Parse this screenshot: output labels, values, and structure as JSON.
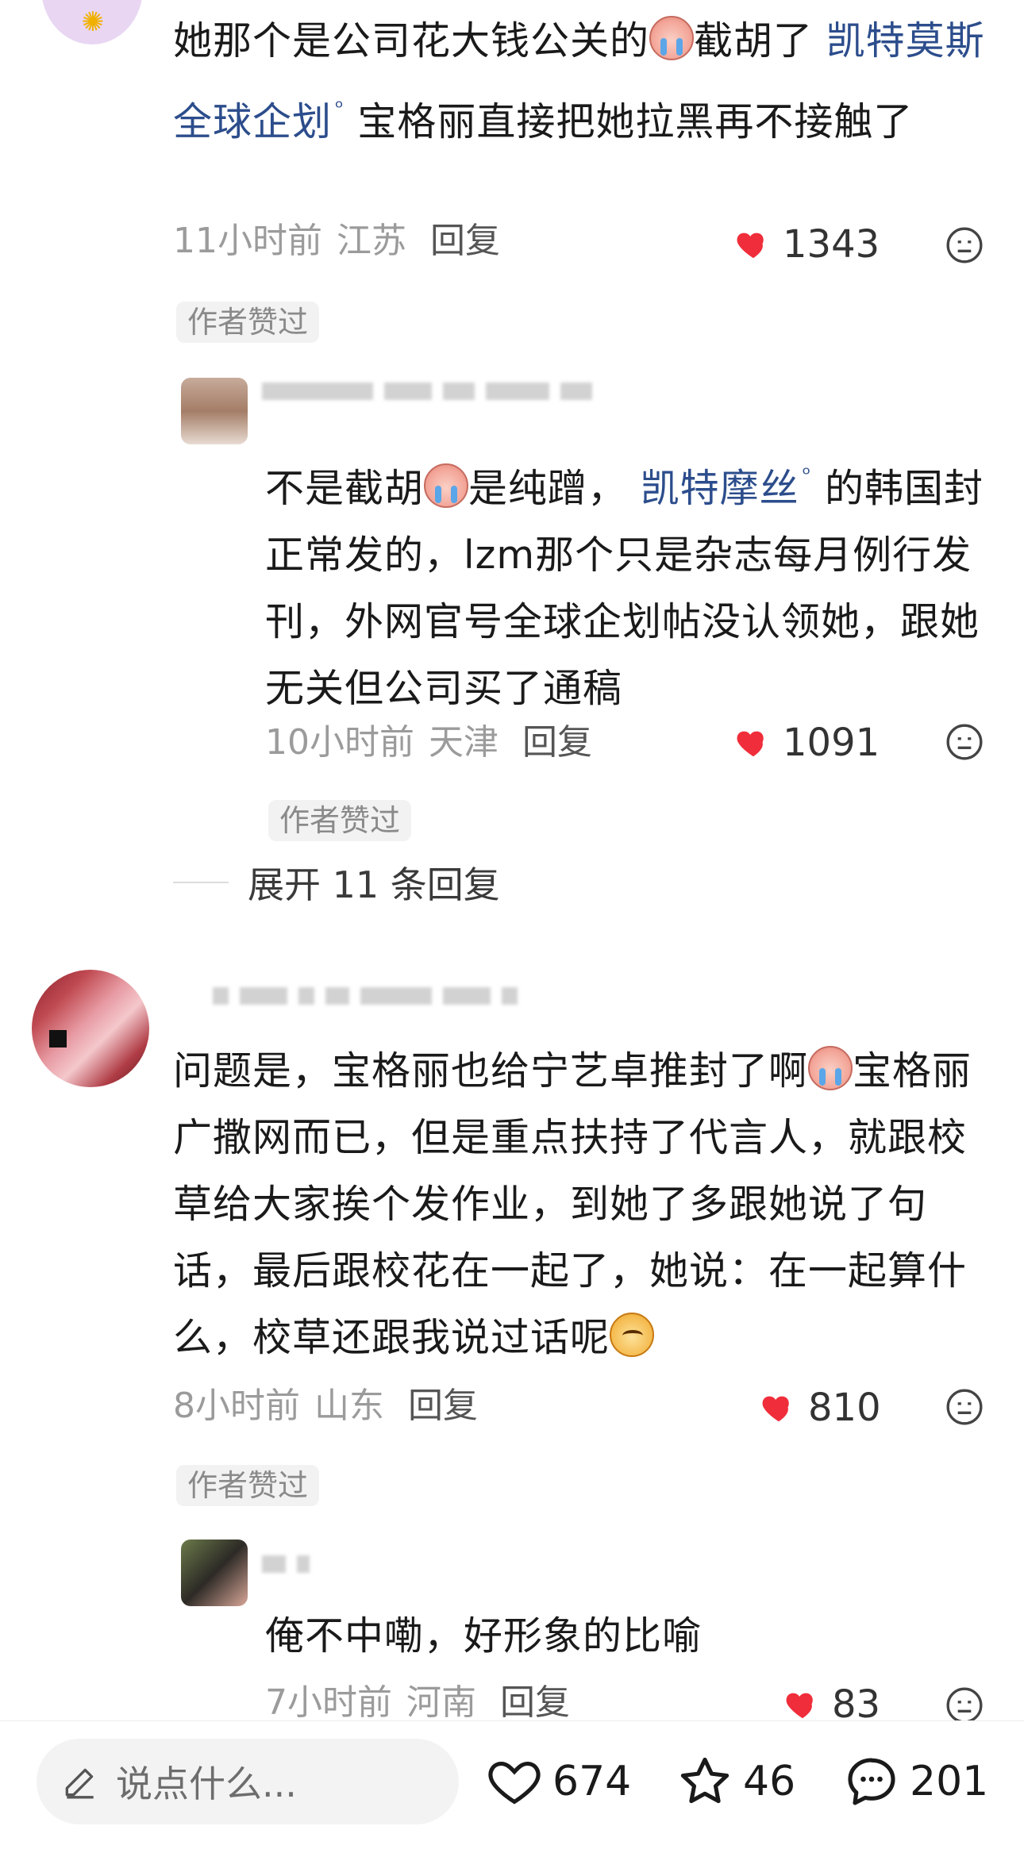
{
  "colors": {
    "mention": "#2c4d8c",
    "heart": "#f02d3a",
    "meta_gray": "#9b9b9b",
    "tag_bg": "#f2f2f2"
  },
  "comments": [
    {
      "text_parts": {
        "p1": "她那个是公司花大钱公关的",
        "emoji1": "crying-emoji",
        "p2": "截胡了 ",
        "mention": "凯特莫斯全球企划",
        "p3": " 宝格丽直接把她拉黑再不接触了"
      },
      "time": "11小时前",
      "location": "江苏",
      "reply_label": "回复",
      "likes": "1343",
      "liked_by_author": "作者赞过"
    },
    {
      "text_parts": {
        "p1": "不是截胡",
        "emoji1": "crying-emoji",
        "p2": "是纯蹭， ",
        "mention": "凯特摩丝",
        "p3": " 的韩国封正常发的，lzm那个只是杂志每月例行发刊，外网官号全球企划帖没认领她，跟她无关但公司买了通稿"
      },
      "time": "10小时前",
      "location": "天津",
      "reply_label": "回复",
      "likes": "1091",
      "liked_by_author": "作者赞过"
    },
    {
      "text_parts": {
        "p1": "问题是，宝格丽也给宁艺卓推封了啊",
        "emoji1": "crying-emoji",
        "p2": "宝格丽广撒网而已，但是重点扶持了代言人，就跟校草给大家挨个发作业，到她了多跟她说了句话，最后跟校花在一起了，她说：在一起算什么，校草还跟我说过话呢",
        "emoji2": "smug-emoji"
      },
      "time": "8小时前",
      "location": "山东",
      "reply_label": "回复",
      "likes": "810",
      "liked_by_author": "作者赞过"
    },
    {
      "text_parts": {
        "p1": "俺不中嘞，好形象的比喻"
      },
      "time": "7小时前",
      "location": "河南",
      "reply_label": "回复",
      "likes": "83"
    }
  ],
  "expand_replies": "展开 11 条回复",
  "bottom_bar": {
    "input_placeholder": "说点什么...",
    "likes": "674",
    "favorites": "46",
    "comments": "201"
  }
}
